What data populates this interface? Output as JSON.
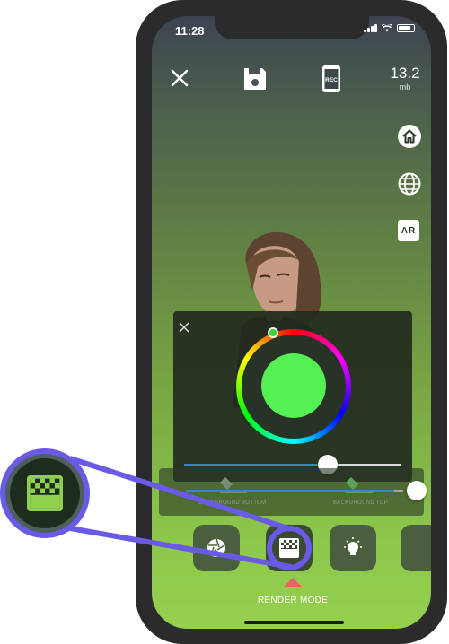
{
  "status": {
    "time": "11:28"
  },
  "header": {
    "size_value": "13.2",
    "size_unit": "mb"
  },
  "side_toolbar": {
    "ar_label": "AR"
  },
  "icons": {
    "close": "close-icon",
    "save": "floppy-disk-icon",
    "record": "record-icon",
    "home": "home-icon",
    "globe": "globe-icon",
    "ar": "ar-icon",
    "aperture": "aperture-icon",
    "render_mode": "checkerboard-gradient-icon",
    "light": "light-bulb-icon"
  },
  "color_picker": {
    "selected_color": "#54f054",
    "brightness_level": 0.78
  },
  "background_bar": {
    "bottom_label": "BACKGROUND BOTTOM",
    "top_label": "BACKGROUND TOP",
    "level": 0.84
  },
  "footer": {
    "mode_label": "RENDER MODE"
  },
  "colors": {
    "accent": "#6a5be6",
    "indicator": "#e56666",
    "slider_track": "#3a87c8"
  }
}
